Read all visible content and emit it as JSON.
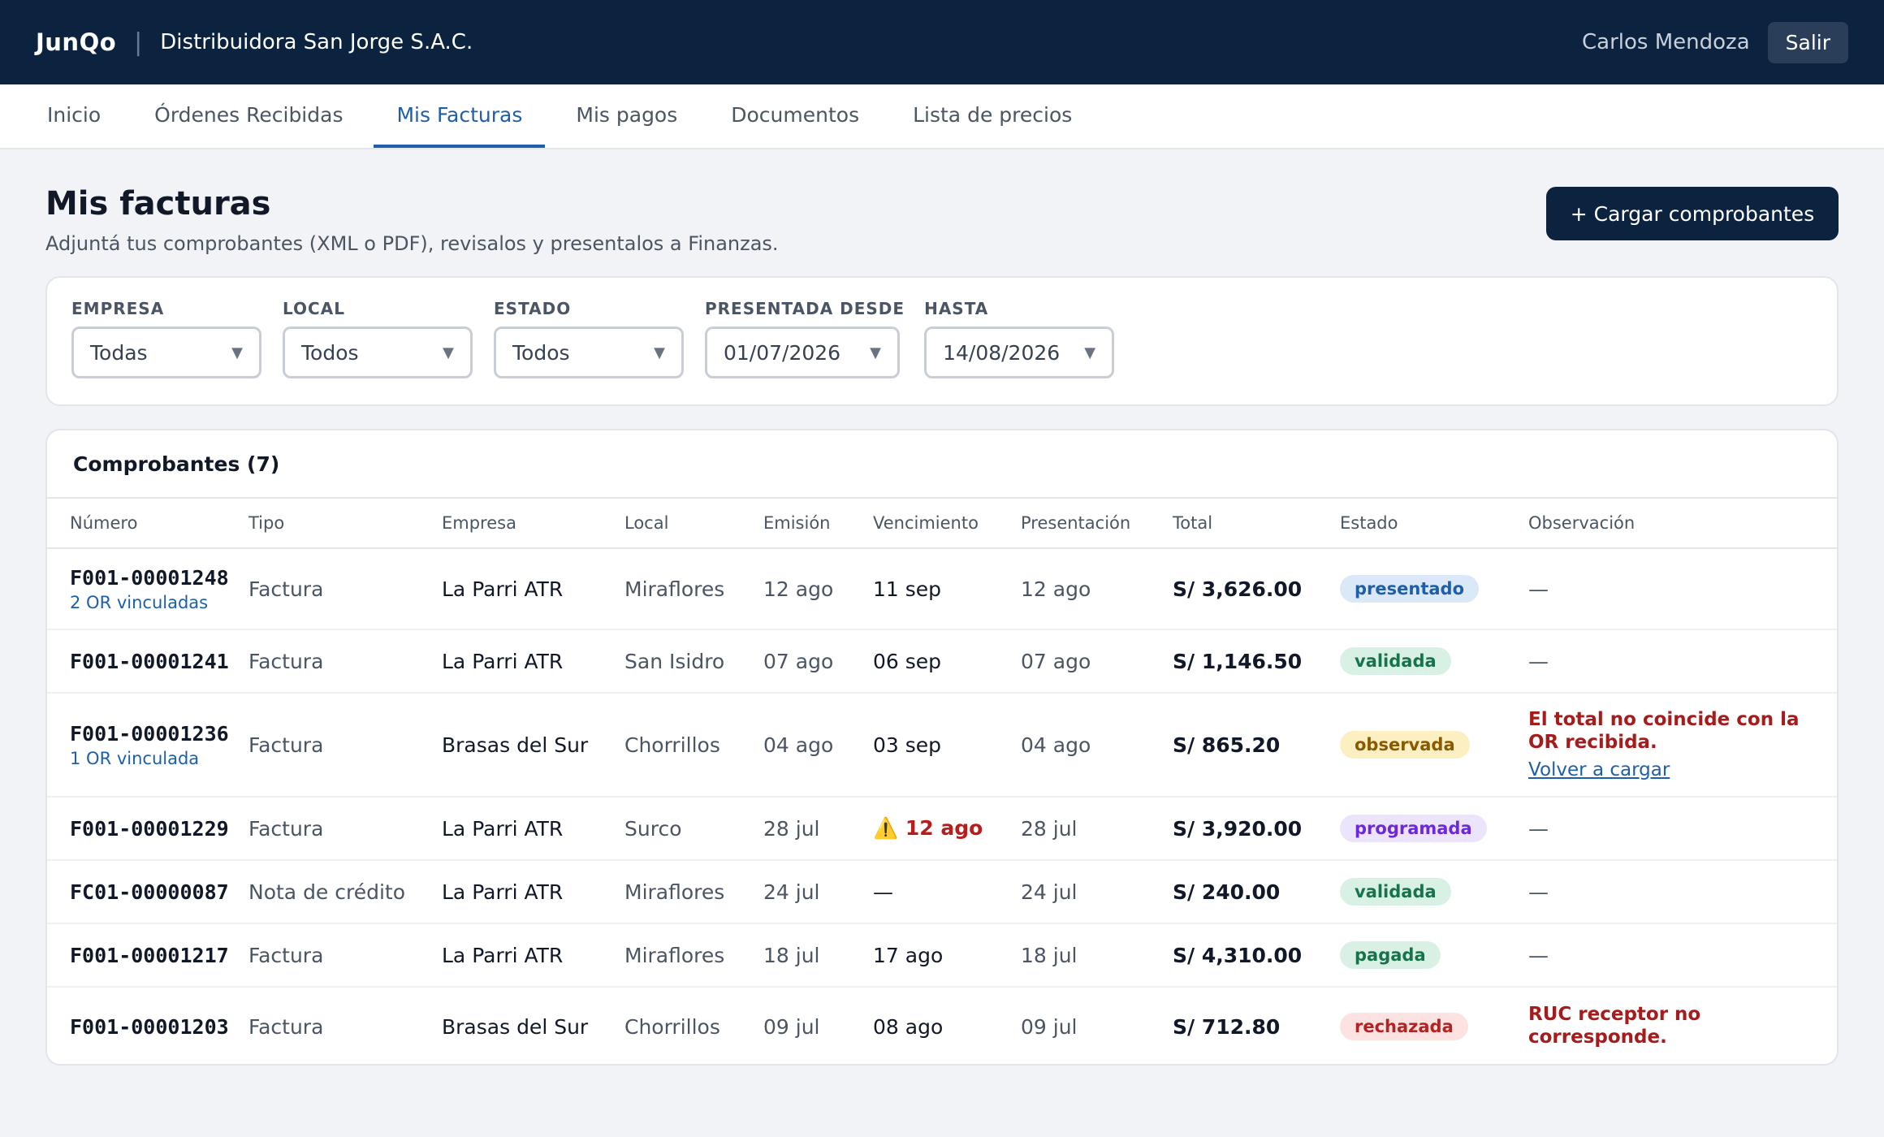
{
  "header": {
    "logo": "JunQo",
    "separator": "|",
    "company": "Distribuidora San Jorge S.A.C.",
    "user": "Carlos Mendoza",
    "logout_label": "Salir"
  },
  "tabs": [
    {
      "label": "Inicio"
    },
    {
      "label": "Órdenes Recibidas"
    },
    {
      "label": "Mis Facturas",
      "active": true
    },
    {
      "label": "Mis pagos"
    },
    {
      "label": "Documentos"
    },
    {
      "label": "Lista de precios"
    }
  ],
  "page": {
    "title": "Mis facturas",
    "subtitle": "Adjuntá tus comprobantes (XML o PDF), revisalos y presentalos a Finanzas.",
    "upload_label": "+ Cargar comprobantes"
  },
  "filters": {
    "empresa": {
      "label": "EMPRESA",
      "value": "Todas"
    },
    "local": {
      "label": "LOCAL",
      "value": "Todos"
    },
    "estado": {
      "label": "ESTADO",
      "value": "Todos"
    },
    "desde": {
      "label": "PRESENTADA DESDE",
      "value": "01/07/2026"
    },
    "hasta": {
      "label": "HASTA",
      "value": "14/08/2026"
    },
    "caret": "▼"
  },
  "table": {
    "title": "Comprobantes (7)",
    "columns": {
      "numero": "Número",
      "tipo": "Tipo",
      "empresa": "Empresa",
      "local": "Local",
      "emision": "Emisión",
      "vencimiento": "Vencimiento",
      "presentacion": "Presentación",
      "total": "Total",
      "estado": "Estado",
      "observacion": "Observación"
    },
    "rows": [
      {
        "numero": "F001-00001248",
        "sub": "2 OR vinculadas",
        "tipo": "Factura",
        "empresa": "La Parri ATR",
        "local": "Miraflores",
        "emision": "12 ago",
        "vencimiento": "11 sep",
        "presentacion": "12 ago",
        "total": "S/ 3,626.00",
        "estado": "presentado",
        "obs": "—"
      },
      {
        "numero": "F001-00001241",
        "tipo": "Factura",
        "empresa": "La Parri ATR",
        "local": "San Isidro",
        "emision": "07 ago",
        "vencimiento": "06 sep",
        "presentacion": "07 ago",
        "total": "S/ 1,146.50",
        "estado": "validada",
        "obs": "—"
      },
      {
        "numero": "F001-00001236",
        "sub": "1 OR vinculada",
        "tipo": "Factura",
        "empresa": "Brasas del Sur",
        "local": "Chorrillos",
        "emision": "04 ago",
        "vencimiento": "03 sep",
        "presentacion": "04 ago",
        "total": "S/ 865.20",
        "estado": "observada",
        "obs_error": "El total no coincide con la OR recibida.",
        "obs_link": "Volver a cargar"
      },
      {
        "numero": "F001-00001229",
        "tipo": "Factura",
        "empresa": "La Parri ATR",
        "local": "Surco",
        "emision": "28 jul",
        "vencimiento": "12 ago",
        "warn": "⚠️",
        "presentacion": "28 jul",
        "total": "S/ 3,920.00",
        "estado": "programada",
        "obs": "—"
      },
      {
        "numero": "FC01-00000087",
        "tipo": "Nota de crédito",
        "empresa": "La Parri ATR",
        "local": "Miraflores",
        "emision": "24 jul",
        "vencimiento": "—",
        "presentacion": "24 jul",
        "total": "S/ 240.00",
        "estado": "validada",
        "obs": "—"
      },
      {
        "numero": "F001-00001217",
        "tipo": "Factura",
        "empresa": "La Parri ATR",
        "local": "Miraflores",
        "emision": "18 jul",
        "vencimiento": "17 ago",
        "presentacion": "18 jul",
        "total": "S/ 4,310.00",
        "estado": "pagada",
        "obs": "—"
      },
      {
        "numero": "F001-00001203",
        "tipo": "Factura",
        "empresa": "Brasas del Sur",
        "local": "Chorrillos",
        "emision": "09 jul",
        "vencimiento": "08 ago",
        "presentacion": "09 jul",
        "total": "S/ 712.80",
        "estado": "rechazada",
        "obs_error": "RUC receptor no corresponde."
      }
    ]
  }
}
